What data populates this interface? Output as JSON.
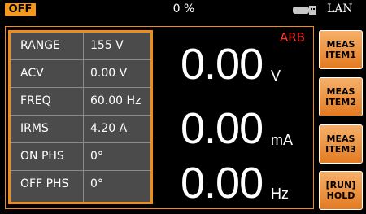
{
  "status_bar": {
    "output_state": "OFF",
    "progress_text": "0 %",
    "network": "LAN"
  },
  "params": [
    {
      "label": "RANGE",
      "value": "155 V"
    },
    {
      "label": "ACV",
      "value": "0.00 V"
    },
    {
      "label": "FREQ",
      "value": "60.00 Hz"
    },
    {
      "label": "IRMS",
      "value": "4.20 A"
    },
    {
      "label": "ON PHS",
      "value": "0°"
    },
    {
      "label": "OFF PHS",
      "value": "0°"
    }
  ],
  "mode_tag": "ARB",
  "measurements": [
    {
      "value": "0.00",
      "unit": "V"
    },
    {
      "value": "0.00",
      "unit": "mA"
    },
    {
      "value": "0.00",
      "unit": "Hz"
    }
  ],
  "softkeys": [
    {
      "line1": "MEAS",
      "line2": "ITEM1"
    },
    {
      "line1": "MEAS",
      "line2": "ITEM2"
    },
    {
      "line1": "MEAS",
      "line2": "ITEM3"
    },
    {
      "line1": "[RUN]",
      "line2": "HOLD"
    }
  ],
  "colors": {
    "accent": "#f08c1a",
    "mode_tag": "#ff3b2f",
    "table_bg": "#4b4b4b"
  }
}
